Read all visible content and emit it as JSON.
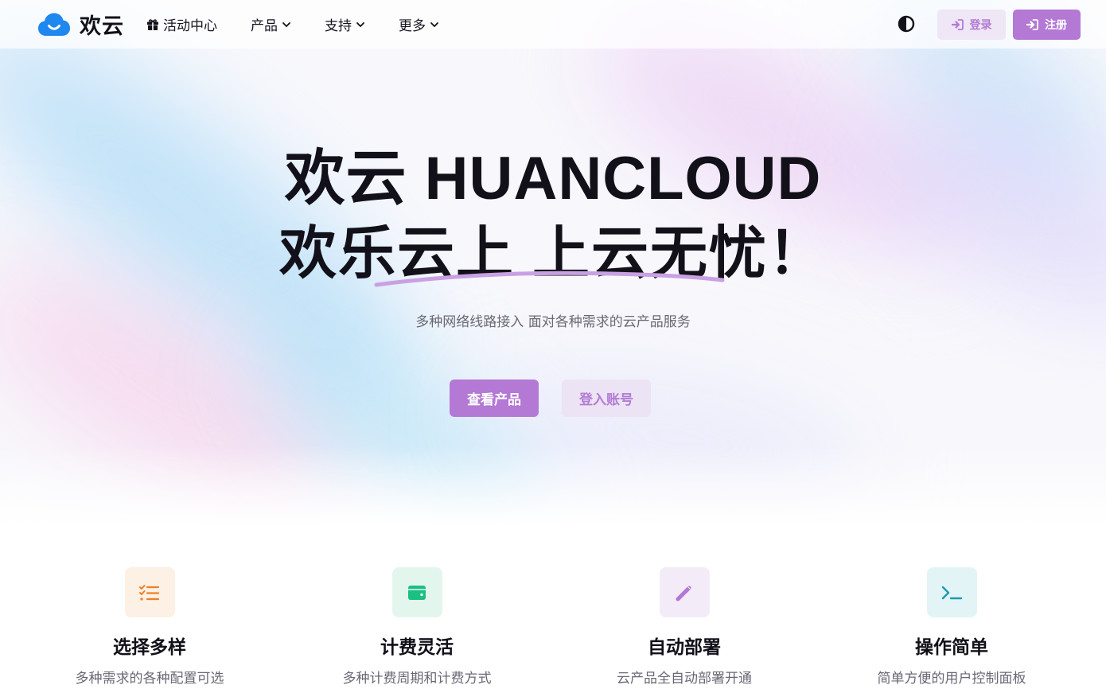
{
  "brand": {
    "name": "欢云",
    "logo_icon": "cloud-smile-icon",
    "logo_color": "#1e87f0"
  },
  "nav": {
    "items": [
      {
        "label": "活动中心",
        "icon": "gift-icon"
      },
      {
        "label": "产品",
        "icon": "chevron-down-icon"
      },
      {
        "label": "支持",
        "icon": "chevron-down-icon"
      },
      {
        "label": "更多",
        "icon": "chevron-down-icon"
      }
    ],
    "theme_toggle_icon": "contrast-icon",
    "login_label": "登录",
    "register_label": "注册"
  },
  "hero": {
    "title_line1": "欢云 HUANCLOUD",
    "title_line2": "欢乐云上 上云无忧！",
    "subtitle": "多种网络线路接入 面对各种需求的云产品服务",
    "primary_button": "查看产品",
    "secondary_button": "登入账号"
  },
  "features": [
    {
      "title": "选择多样",
      "desc": "多种需求的各种配置可选",
      "icon": "checklist-icon",
      "color": "#f07f22"
    },
    {
      "title": "计费灵活",
      "desc": "多种计费周期和计费方式",
      "icon": "wallet-icon",
      "color": "#1cbf82"
    },
    {
      "title": "自动部署",
      "desc": "云产品全自动部署开通",
      "icon": "pencil-icon",
      "color": "#b478d5"
    },
    {
      "title": "操作简单",
      "desc": "简单方便的用户控制面板",
      "icon": "terminal-icon",
      "color": "#1a9bb3"
    }
  ],
  "colors": {
    "accent": "#b478d5",
    "accent_soft": "#efe6f6",
    "text": "#121019",
    "muted": "#6a6875"
  }
}
